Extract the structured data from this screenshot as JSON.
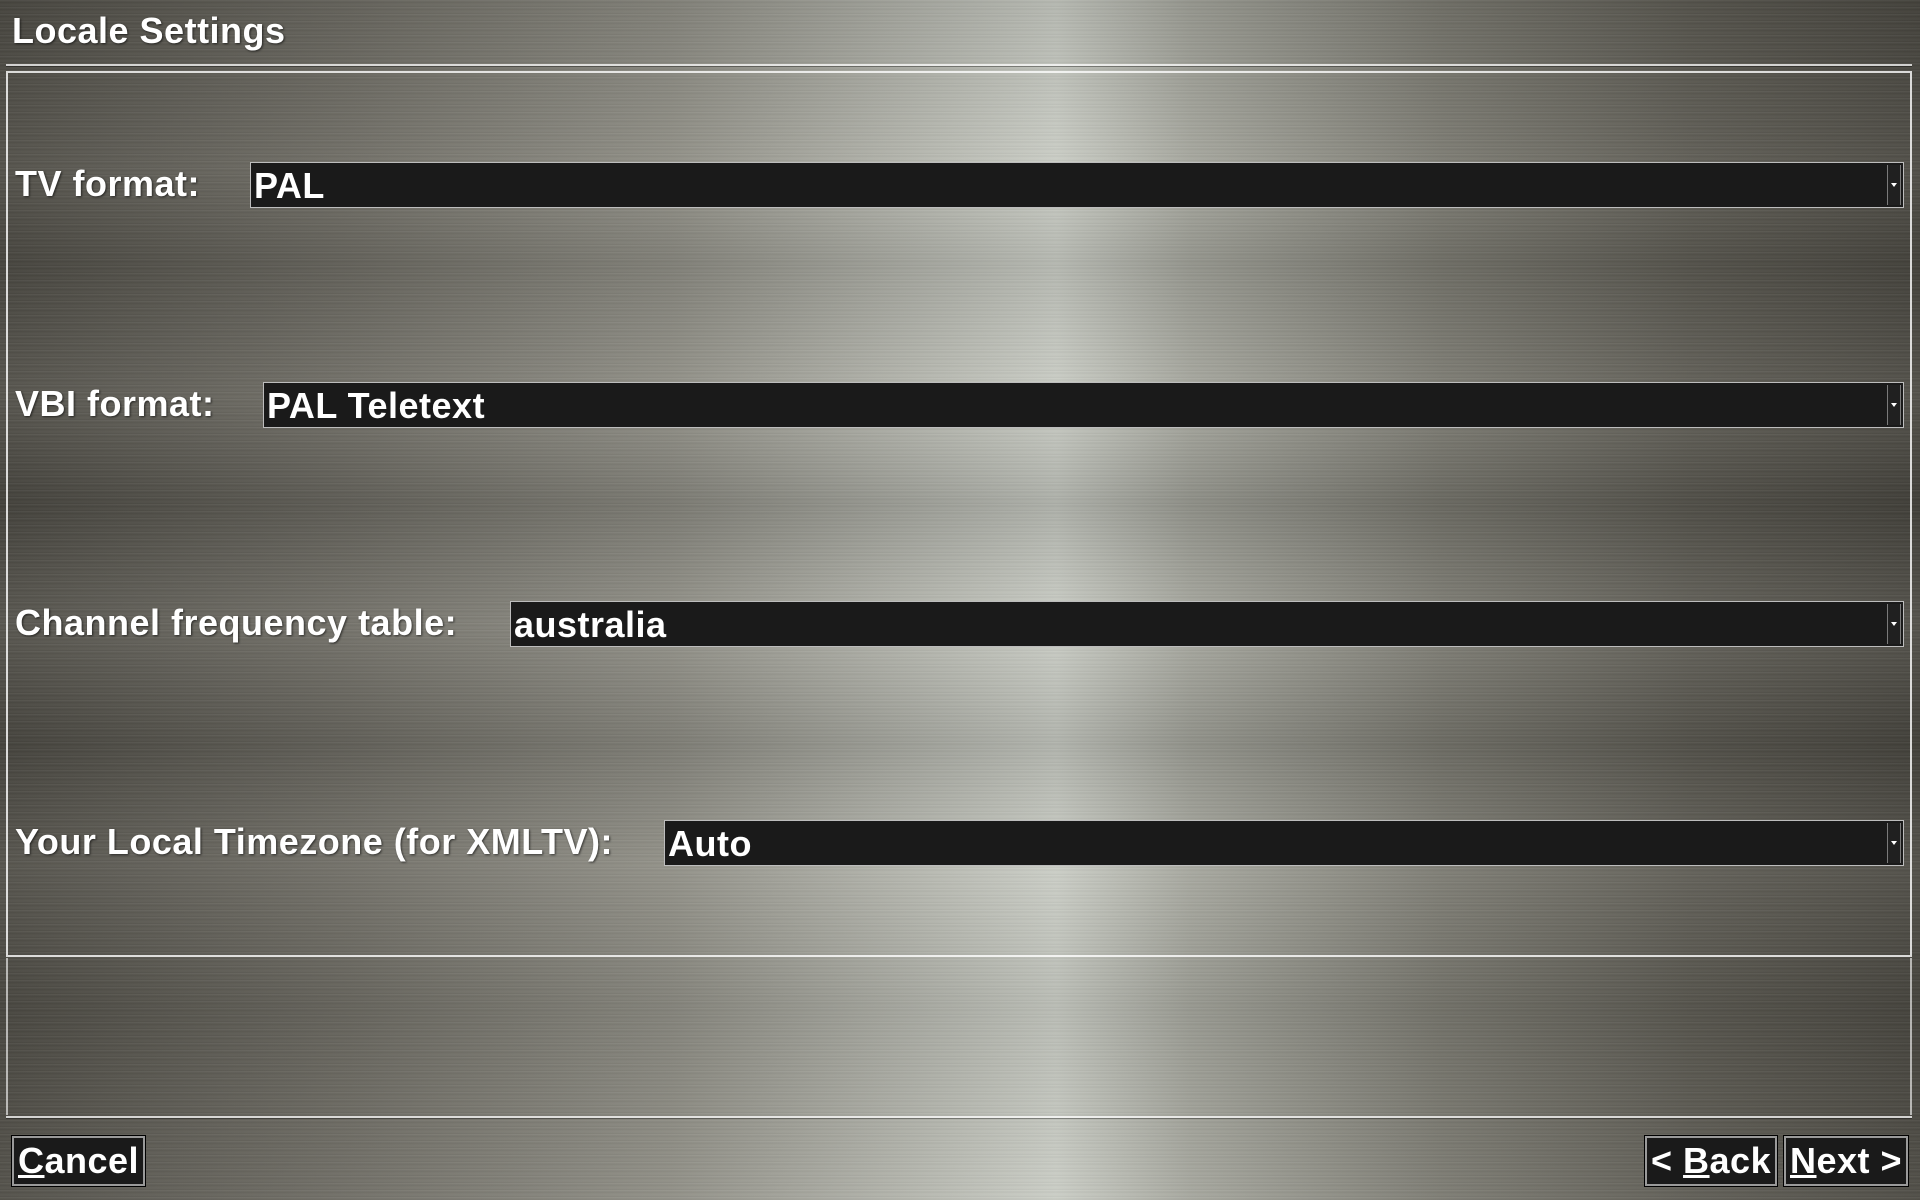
{
  "window": {
    "title": "Locale Settings"
  },
  "fields": [
    {
      "label": "TV format:",
      "value": "PAL"
    },
    {
      "label": "VBI format:",
      "value": "PAL Teletext"
    },
    {
      "label": "Channel frequency table:",
      "value": "australia"
    },
    {
      "label": "Your Local Timezone (for XMLTV):",
      "value": "Auto"
    }
  ],
  "buttons": {
    "cancel": {
      "mnemonic": "C",
      "rest": "ancel"
    },
    "back": {
      "prefix": "< ",
      "mnemonic": "B",
      "rest": "ack"
    },
    "next": {
      "mnemonic": "N",
      "rest": "ext >"
    }
  },
  "colors": {
    "field_background": "#1a1a1a",
    "text": "#ffffff"
  }
}
